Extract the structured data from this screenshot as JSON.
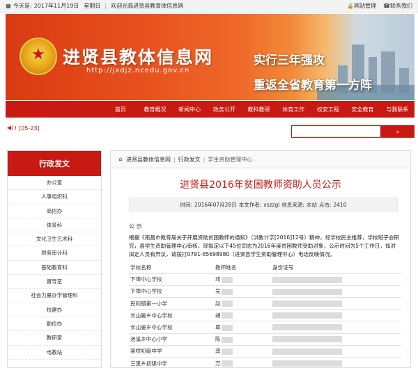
{
  "topbar": {
    "date_prefix": "今天是:",
    "date": "2017年11月19日",
    "weekday": "星期日",
    "welcome": "欢迎光临进贤县教育体信息网",
    "links": [
      {
        "label": "网站管理",
        "icon": "lock-icon"
      },
      {
        "label": "联系我们",
        "icon": "phone-icon"
      }
    ]
  },
  "banner": {
    "site_title": "进贤县教体信息网",
    "site_url": "http://jxdjz.ncedu.gov.cn",
    "slogan_line1": "实行三年强攻",
    "slogan_line2": "重返全省教育第一方阵"
  },
  "nav": {
    "items": [
      "首页",
      "教育概况",
      "新闻中心",
      "政务公开",
      "教科教研",
      "体育工作",
      "校安工程",
      "安全教育",
      "与我联系"
    ]
  },
  "notice": {
    "text": "!",
    "date": "[05-23]"
  },
  "search": {
    "placeholder": "",
    "button_icon": "search-icon"
  },
  "sidebar": {
    "heading": "行政发文",
    "items": [
      "办公室",
      "人事组织科",
      "高招办",
      "体育科",
      "文化卫生艺术科",
      "财务审计科",
      "基础教育科",
      "督导室",
      "社会力量办学管理科",
      "校建办",
      "勤俭办",
      "教研室",
      "电教站"
    ]
  },
  "breadcrumb": {
    "home": "进贤县教体信息网",
    "level1": "行政发文",
    "level2": "学生资助管理中心"
  },
  "article": {
    "title": "进贤县2016年贫困教师资助人员公示",
    "meta": {
      "time_label": "时间:",
      "time": "2016年07月28日",
      "author_label": "本文作者:",
      "author": "xszzgl",
      "source_label": "信息来源:",
      "source": "本站",
      "clicks_label": "点击:",
      "clicks": "2410"
    },
    "announcement_heading": "公  示",
    "body": "根据《南昌市教育局关于开展资助贫困教师的通知》（洪教计字[2016]12号）精神，经学校民主推荐，学校班子会研究，县学生资助管理中心审核，现拟定以下45位同志为2016年度贫困教师受助对象，公示时间为5个工作日，如对拟定人员有异议，请拨打0791-85698980（进贤县学生资助管理中心）电话反映情况。",
    "table": {
      "headers": [
        "学校名称",
        "教师姓名",
        "身份证号"
      ],
      "rows": [
        {
          "school": "下埠中心学校",
          "name": "邓"
        },
        {
          "school": "下埠中心学校",
          "name": "吴"
        },
        {
          "school": "民和镇第一小学",
          "name": "赵"
        },
        {
          "school": "长山晏乡中心学校",
          "name": "胡"
        },
        {
          "school": "长山晏乡中心学校",
          "name": "章"
        },
        {
          "school": "池溪乡中心小学",
          "name": "陈"
        },
        {
          "school": "架桥初级中学",
          "name": "龚"
        },
        {
          "school": "三里乡初级中学",
          "name": "万"
        }
      ]
    }
  },
  "colors": {
    "brand_red": "#c81912",
    "topbar_bg": "#f3f3f3"
  }
}
